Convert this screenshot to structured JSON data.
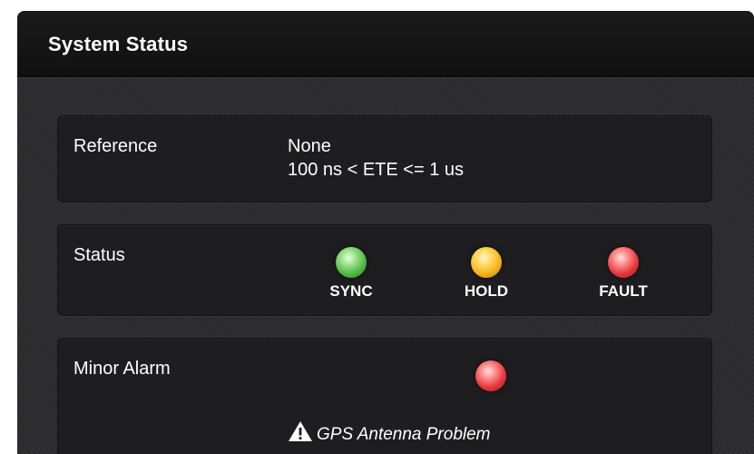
{
  "panel": {
    "title": "System Status"
  },
  "reference": {
    "label": "Reference",
    "value": "None",
    "ete": "100 ns < ETE <= 1 us"
  },
  "status": {
    "label": "Status",
    "indicators": [
      {
        "label": "SYNC",
        "color": "#52b844"
      },
      {
        "label": "HOLD",
        "color": "#f0b21a"
      },
      {
        "label": "FAULT",
        "color": "#e5383e"
      }
    ]
  },
  "minor_alarm": {
    "label": "Minor Alarm",
    "led_color": "#e5383e",
    "icon": "warning-icon",
    "message": "GPS Antenna Problem"
  }
}
